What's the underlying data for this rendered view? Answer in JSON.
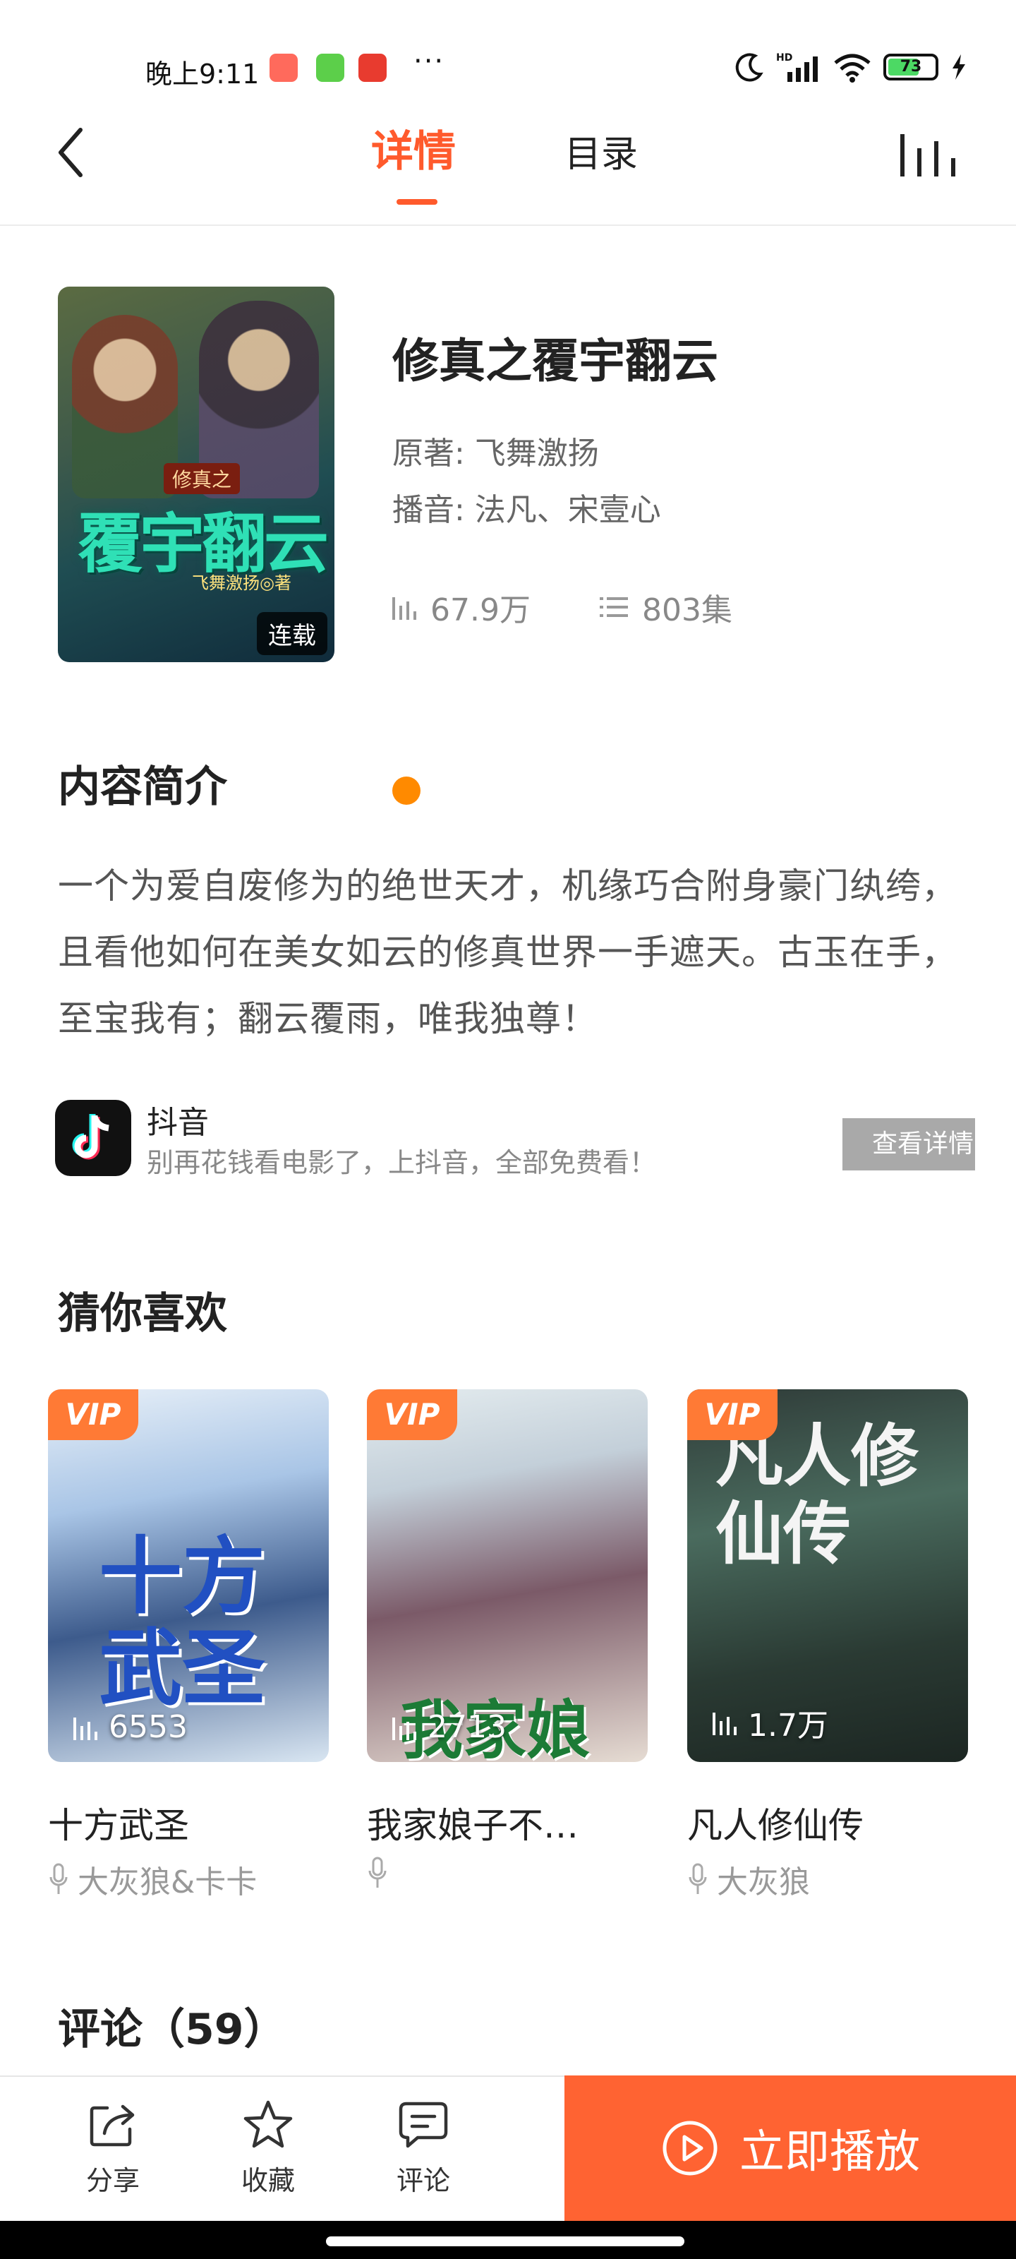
{
  "status_bar": {
    "time": "晚上9:11",
    "more": "···",
    "network": "HD",
    "battery": "73"
  },
  "nav": {
    "tab_detail": "详情",
    "tab_toc": "目录"
  },
  "book": {
    "cover_subtitle": "修真之",
    "cover_title": "覆宇翻云",
    "cover_author": "飞舞激扬◎著",
    "cover_badge": "连载",
    "title": "修真之覆宇翻云",
    "author_line": "原著:  飞舞激扬",
    "narrator_line": "播音:  法凡、宋壹心",
    "plays": "67.9万",
    "episodes": "803集"
  },
  "intro": {
    "title": "内容简介",
    "text": "一个为爱自废修为的绝世天才，机缘巧合附身豪门纨绔，且看他如何在美女如云的修真世界一手遮天。古玉在手，至宝我有；翻云覆雨，唯我独尊！"
  },
  "ad": {
    "name": "抖音",
    "description": "别再花钱看电影了，上抖音，全部免费看！",
    "button": "查看详情"
  },
  "recommendations": {
    "title": "猜你喜欢",
    "items": [
      {
        "badge": "VIP",
        "cover_text": "十方武圣",
        "plays": "6553",
        "name": "十方武圣",
        "narrator": "大灰狼&卡卡"
      },
      {
        "badge": "VIP",
        "cover_text": "我家娘子",
        "plays": "2713",
        "name": "我家娘子不…",
        "narrator": ""
      },
      {
        "badge": "VIP",
        "cover_text": "凡人修仙传",
        "plays": "1.7万",
        "name": "凡人修仙传",
        "narrator": "大灰狼"
      }
    ]
  },
  "comments": {
    "title": "评论（59）"
  },
  "bottom_bar": {
    "share": "分享",
    "favorite": "收藏",
    "comment": "评论",
    "play": "立即播放"
  },
  "colors": {
    "accent": "#ff5a2c",
    "play_button": "#ff6332",
    "vip_badge": "#ff7a35",
    "intro_dot": "#ff8a00"
  }
}
